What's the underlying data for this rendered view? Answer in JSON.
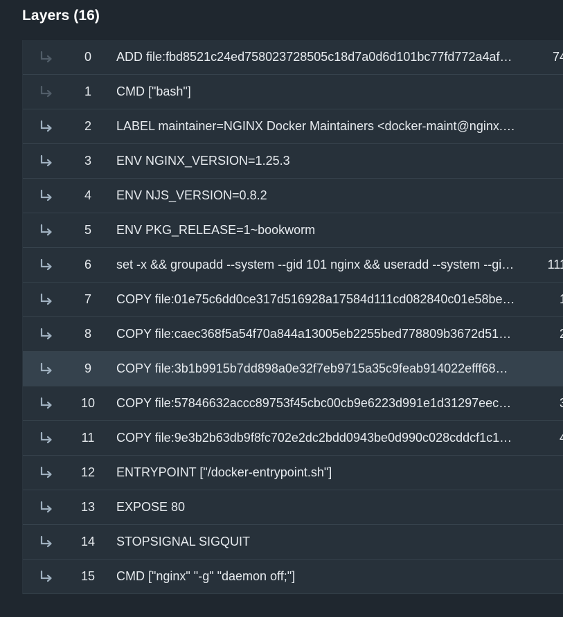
{
  "panel": {
    "title": "Layers (16)"
  },
  "colors": {
    "background": "#1f272f",
    "row": "#27313a",
    "row_selected": "#35424d",
    "text": "#e6eaee",
    "arrow_icon": "#9fb0bf"
  },
  "layers": [
    {
      "index": "0",
      "command": "ADD file:fbd8521c24ed758023728505c18d7a0d6d101bc77fd772a4af…",
      "size": "74",
      "icon": "arrow-down-right-icon",
      "dimmed": true,
      "selected": false
    },
    {
      "index": "1",
      "command": "CMD [\"bash\"]",
      "size": "",
      "icon": "arrow-down-right-icon",
      "dimmed": true,
      "selected": false
    },
    {
      "index": "2",
      "command": "LABEL maintainer=NGINX Docker Maintainers <docker-maint@nginx.c…",
      "size": "",
      "icon": "arrow-down-right-icon",
      "dimmed": false,
      "selected": false
    },
    {
      "index": "3",
      "command": "ENV NGINX_VERSION=1.25.3",
      "size": "",
      "icon": "arrow-down-right-icon",
      "dimmed": false,
      "selected": false
    },
    {
      "index": "4",
      "command": "ENV NJS_VERSION=0.8.2",
      "size": "",
      "icon": "arrow-down-right-icon",
      "dimmed": false,
      "selected": false
    },
    {
      "index": "5",
      "command": "ENV PKG_RELEASE=1~bookworm",
      "size": "",
      "icon": "arrow-down-right-icon",
      "dimmed": false,
      "selected": false
    },
    {
      "index": "6",
      "command": "set -x && groupadd --system --gid 101 nginx && useradd --system --gid…",
      "size": "111",
      "icon": "arrow-down-right-icon",
      "dimmed": false,
      "selected": false
    },
    {
      "index": "7",
      "command": "COPY file:01e75c6dd0ce317d516928a17584d111cd082840c01e58be…",
      "size": "1",
      "icon": "arrow-down-right-icon",
      "dimmed": false,
      "selected": false
    },
    {
      "index": "8",
      "command": "COPY file:caec368f5a54f70a844a13005eb2255bed778809b3672d51…",
      "size": "2",
      "icon": "arrow-down-right-icon",
      "dimmed": false,
      "selected": false
    },
    {
      "index": "9",
      "command": "COPY file:3b1b9915b7dd898a0e32f7eb9715a35c9feab914022efff68…",
      "size": "",
      "icon": "arrow-down-right-icon",
      "dimmed": false,
      "selected": true
    },
    {
      "index": "10",
      "command": "COPY file:57846632accc89753f45cbc00cb9e6223d991e1d31297eec…",
      "size": "3",
      "icon": "arrow-down-right-icon",
      "dimmed": false,
      "selected": false
    },
    {
      "index": "11",
      "command": "COPY file:9e3b2b63db9f8fc702e2dc2bdd0943be0d990c028cddcf1c1…",
      "size": "4",
      "icon": "arrow-down-right-icon",
      "dimmed": false,
      "selected": false
    },
    {
      "index": "12",
      "command": "ENTRYPOINT [\"/docker-entrypoint.sh\"]",
      "size": "",
      "icon": "arrow-down-right-icon",
      "dimmed": false,
      "selected": false
    },
    {
      "index": "13",
      "command": "EXPOSE 80",
      "size": "",
      "icon": "arrow-down-right-icon",
      "dimmed": false,
      "selected": false
    },
    {
      "index": "14",
      "command": "STOPSIGNAL SIGQUIT",
      "size": "",
      "icon": "arrow-down-right-icon",
      "dimmed": false,
      "selected": false
    },
    {
      "index": "15",
      "command": "CMD [\"nginx\" \"-g\" \"daemon off;\"]",
      "size": "",
      "icon": "arrow-down-right-icon",
      "dimmed": false,
      "selected": false
    }
  ]
}
